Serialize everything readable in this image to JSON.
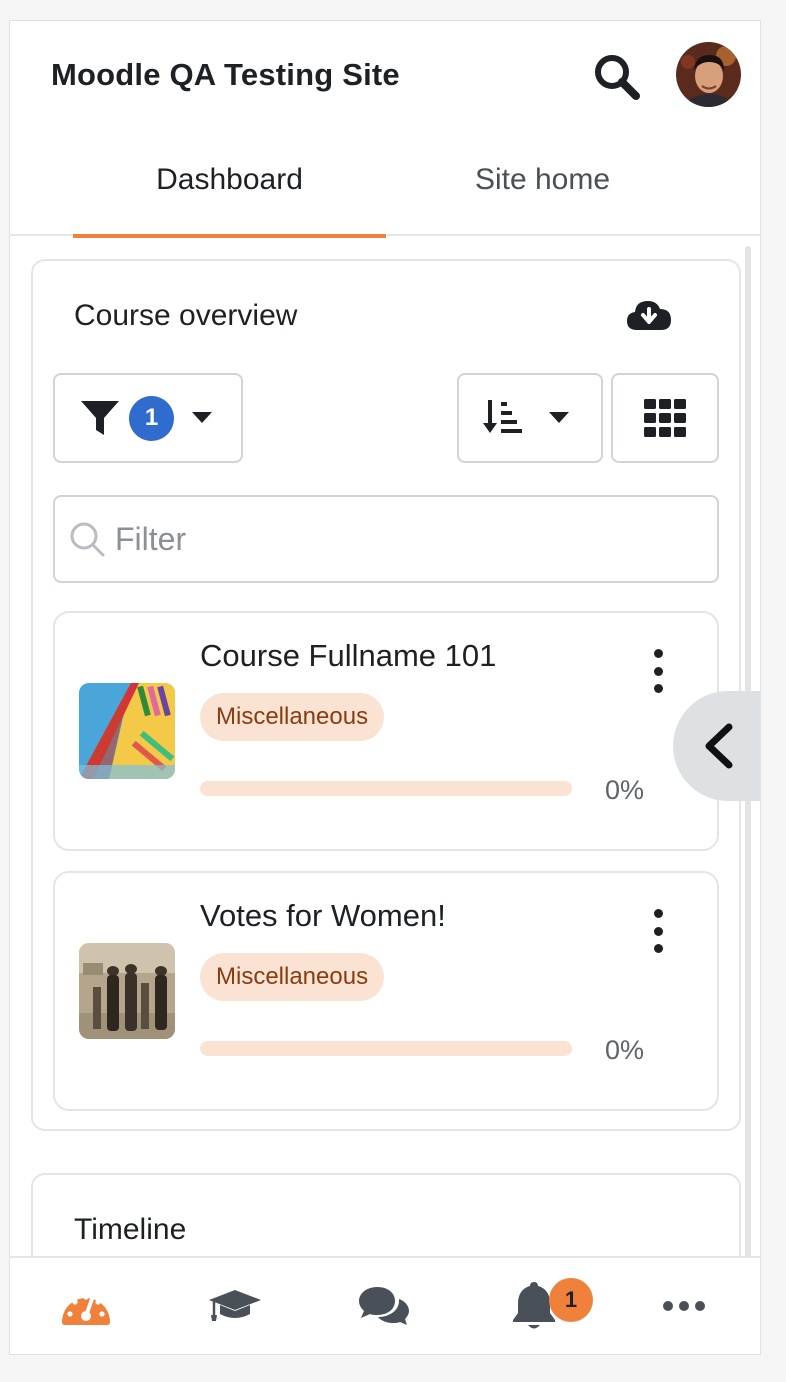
{
  "header": {
    "site_title": "Moodle QA Testing Site"
  },
  "tabs": [
    {
      "label": "Dashboard",
      "active": true
    },
    {
      "label": "Site home",
      "active": false
    }
  ],
  "course_overview": {
    "title": "Course overview",
    "filter_count": "1",
    "search_placeholder": "Filter",
    "courses": [
      {
        "name": "Course Fullname 101",
        "category": "Miscellaneous",
        "progress_text": "0%",
        "progress": 0
      },
      {
        "name": "Votes for Women!",
        "category": "Miscellaneous",
        "progress_text": "0%",
        "progress": 0
      }
    ]
  },
  "timeline": {
    "title": "Timeline"
  },
  "footer": {
    "notification_count": "1",
    "items": [
      "dashboard-icon",
      "courses-icon",
      "messages-icon",
      "notifications-icon",
      "more-icon"
    ]
  },
  "colors": {
    "accent": "#f0813b",
    "badge_blue": "#2f6ccd",
    "category_bg": "#fbe3d3",
    "category_text": "#8a3c11"
  }
}
